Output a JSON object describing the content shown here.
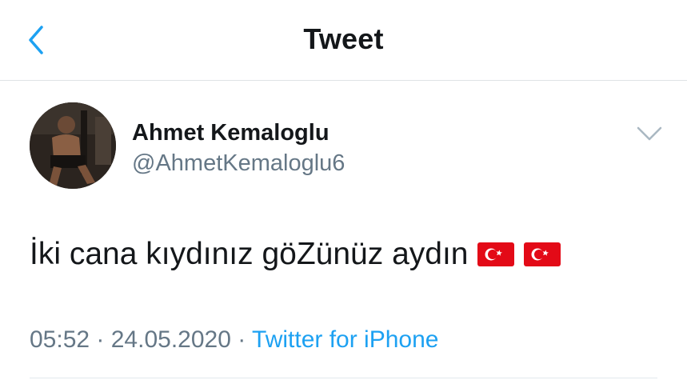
{
  "header": {
    "title": "Tweet"
  },
  "author": {
    "name": "Ahmet Kemaloglu",
    "handle": "@AhmetKemaloglu6"
  },
  "tweet": {
    "text": "İki cana kıydınız göZünüz aydın",
    "emojis": [
      "turkey-flag",
      "turkey-flag"
    ]
  },
  "meta": {
    "time": "05:52",
    "sep1": " · ",
    "date": "24.05.2020",
    "sep2": " · ",
    "source": "Twitter for iPhone"
  },
  "colors": {
    "accent": "#1da1f2",
    "muted": "#657786",
    "text": "#14171a",
    "flag_red": "#e30a17"
  }
}
